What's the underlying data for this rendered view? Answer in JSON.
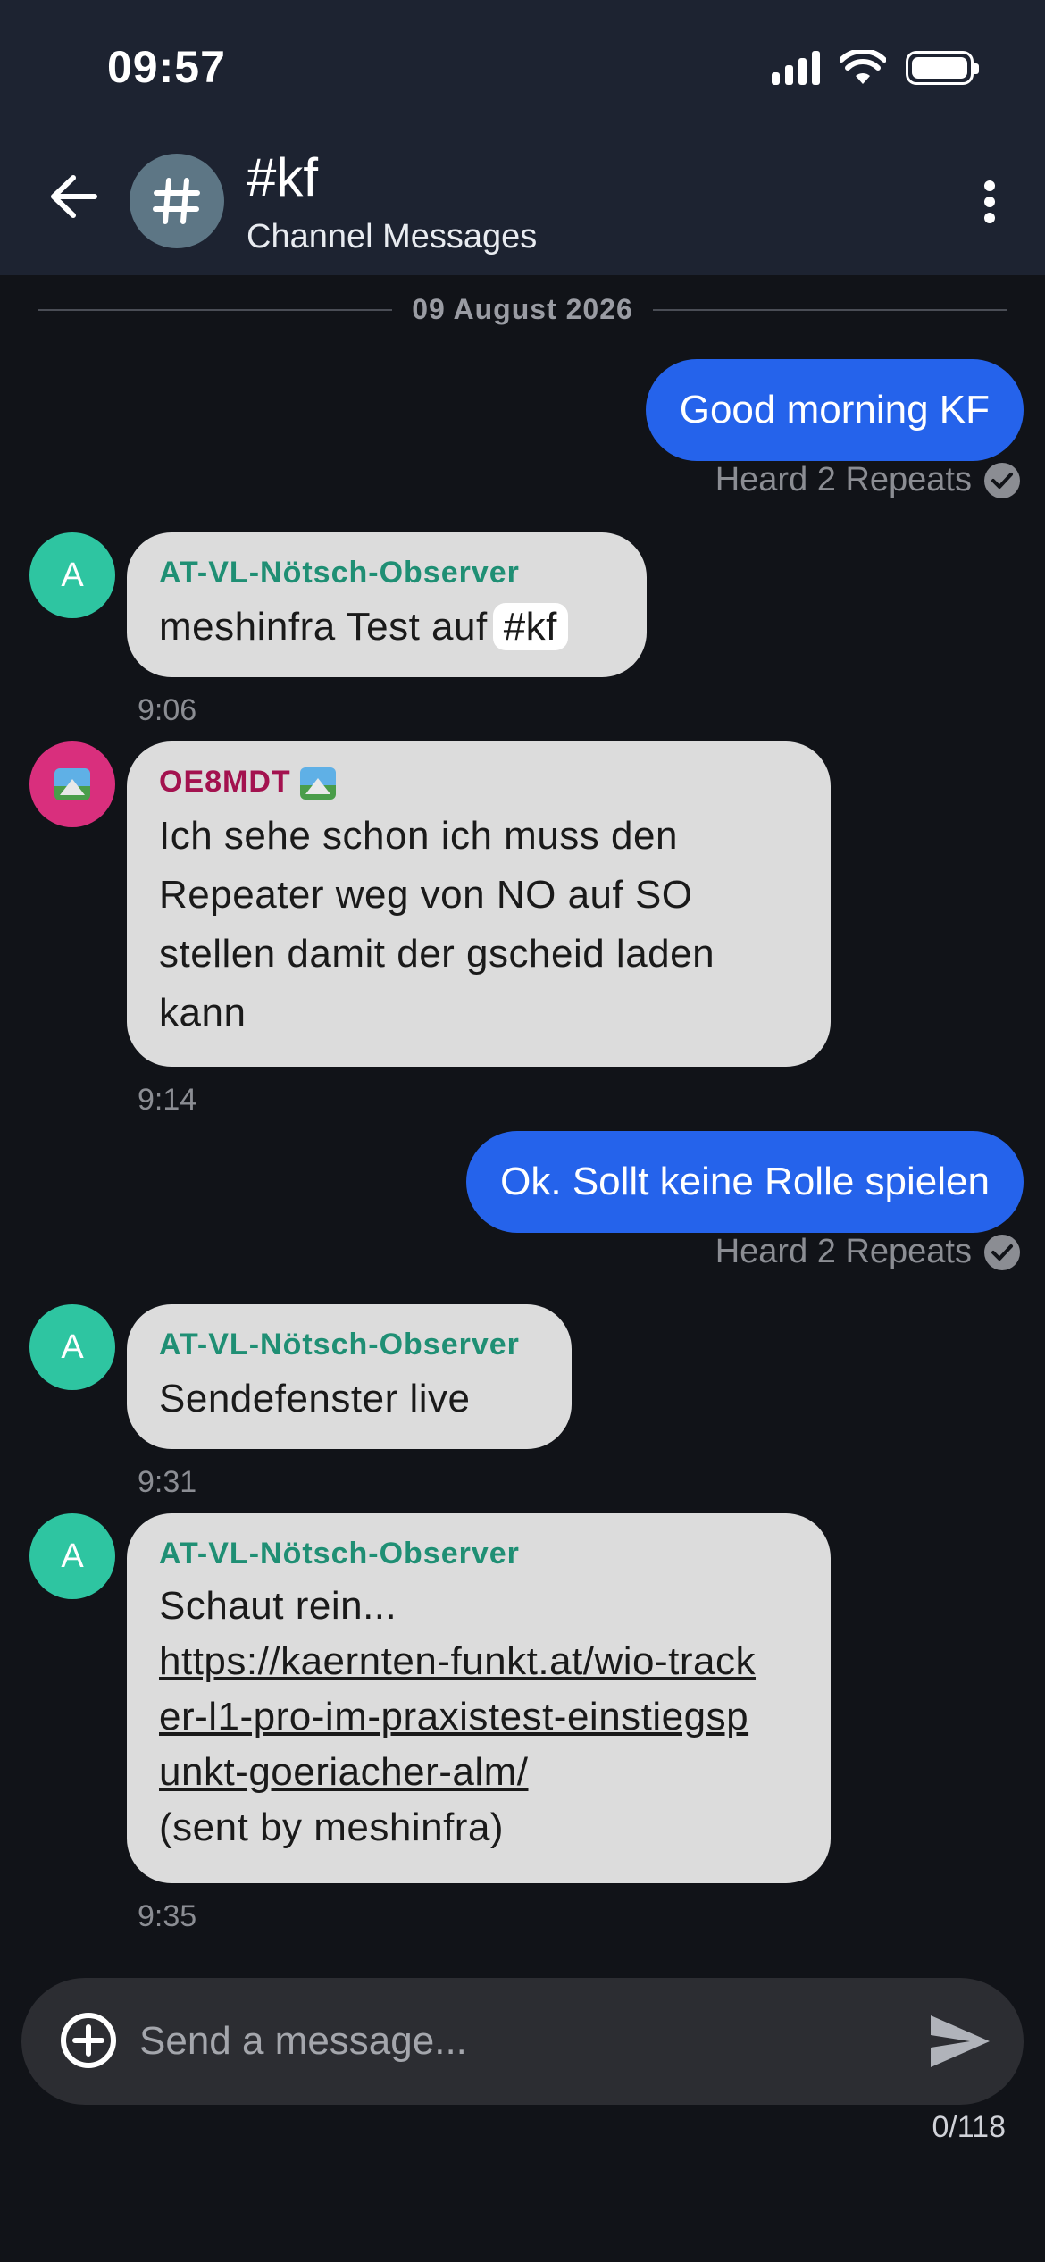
{
  "status_bar": {
    "time": "09:57"
  },
  "header": {
    "back_icon": "arrow-left-icon",
    "channel_icon": "hash-icon",
    "title": "#kf",
    "subtitle": "Channel Messages",
    "menu_icon": "more-vert-icon"
  },
  "date_divider": "09 August 2026",
  "messages": [
    {
      "direction": "out",
      "text": "Good morning KF",
      "status": "Heard 2 Repeats"
    },
    {
      "direction": "in",
      "avatar": "A",
      "sender": "AT-VL-Nötsch-Observer",
      "text": "meshinfra Test auf",
      "tag": "#kf",
      "time": "9:06"
    },
    {
      "direction": "in",
      "avatar_icon": "picture-emoji-icon",
      "sender": "OE8MDT",
      "text": "Ich sehe schon ich muss den Repeater weg von NO auf SO stellen damit der gscheid laden kann",
      "time": "9:14"
    },
    {
      "direction": "out",
      "text": "Ok. Sollt keine Rolle spielen",
      "status": "Heard 2 Repeats"
    },
    {
      "direction": "in",
      "avatar": "A",
      "sender": "AT-VL-Nötsch-Observer",
      "text": "Sendefenster live",
      "time": "9:31"
    },
    {
      "direction": "in",
      "avatar": "A",
      "sender": "AT-VL-Nötsch-Observer",
      "text_before": "Schaut rein...",
      "link": "https://kaernten-funkt.at/wio-tracker-l1-pro-im-praxistest-einstiegspunkt-goeriacher-alm/",
      "text_after": "(sent by meshinfra)",
      "time": "9:35"
    }
  ],
  "composer": {
    "placeholder": "Send a message...",
    "counter": "0/118",
    "add_icon": "plus-circle-icon",
    "send_icon": "send-icon"
  },
  "colors": {
    "header_bg": "#1d2331",
    "background": "#111318",
    "outgoing_bubble": "#2563eb",
    "incoming_bubble": "#dcdcdc",
    "sender_teal": "#1f8f74",
    "sender_pink": "#a3124f",
    "avatar_teal": "#2ec5a1",
    "avatar_pink": "#d92f7d"
  }
}
